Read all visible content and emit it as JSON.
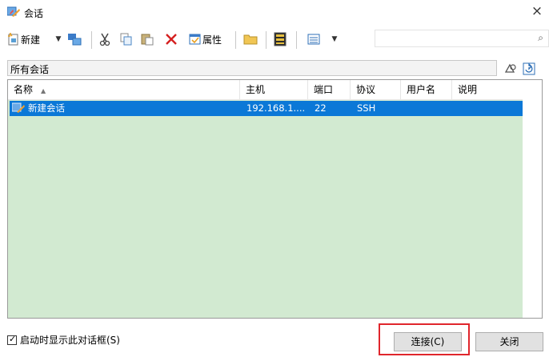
{
  "window": {
    "title": "会话",
    "close_glyph": "×"
  },
  "toolbar": {
    "new_label": "新建",
    "properties_label": "属性",
    "search_placeholder": ""
  },
  "path": {
    "label": "所有会话"
  },
  "table": {
    "columns": [
      "名称",
      "主机",
      "端口",
      "协议",
      "用户名",
      "说明"
    ],
    "rows": [
      {
        "name": "新建会话",
        "host": "192.168.1....",
        "port": "22",
        "protocol": "SSH",
        "user": "",
        "desc": ""
      }
    ]
  },
  "footer": {
    "startup_checkbox_label": "启动时显示此对话框(S)",
    "startup_checked": true,
    "connect_label": "连接(C)",
    "close_label": "关闭"
  },
  "colors": {
    "accent": "#0b78d7",
    "list_background": "#d2ead1",
    "highlight_border": "#e0262c"
  },
  "icons": [
    "session-app-icon",
    "new-session-icon",
    "dropdown-caret-icon",
    "transfer-icon",
    "cut-icon",
    "copy-icon",
    "paste-icon",
    "delete-icon",
    "properties-icon",
    "folder-icon",
    "terminal-icon",
    "view-list-icon",
    "search-icon",
    "reload-icon",
    "refresh-icon",
    "session-icon"
  ]
}
